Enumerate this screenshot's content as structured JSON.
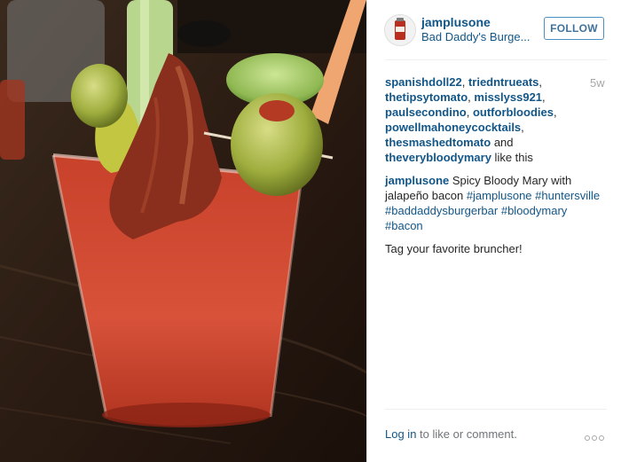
{
  "post": {
    "photo_icon": "bloody-mary-photo",
    "header": {
      "avatar_icon": "profile-avatar-icon",
      "username": "jamplusone",
      "location": "Bad Daddy's Burge...",
      "follow_label": "FOLLOW",
      "follow_color": "#3f729b"
    },
    "likes": {
      "users": [
        "spanishdoll22",
        "triedntrueats",
        "thetipsytomato",
        "misslyss921",
        "paulsecondino",
        "outforbloodies",
        "powellmahoneycocktails",
        "thesmashedtomato",
        "theverybloodymary"
      ],
      "separator": ", ",
      "and_text": " and ",
      "suffix": " like this"
    },
    "timestamp": "5w",
    "caption": {
      "user": "jamplusone",
      "text": " Spicy Bloody Mary with jalapeño bacon ",
      "tags": [
        "#jamplusone",
        "#huntersville",
        "#baddaddysburgerbar",
        "#bloodymary",
        "#bacon"
      ]
    },
    "comment": "Tag your favorite bruncher!",
    "footer": {
      "login_label": "Log in",
      "login_suffix": " to like or comment.",
      "more_icon": "more-options-icon"
    },
    "colors": {
      "link": "#125688",
      "muted": "#a5a7aa",
      "text": "#262626"
    }
  }
}
